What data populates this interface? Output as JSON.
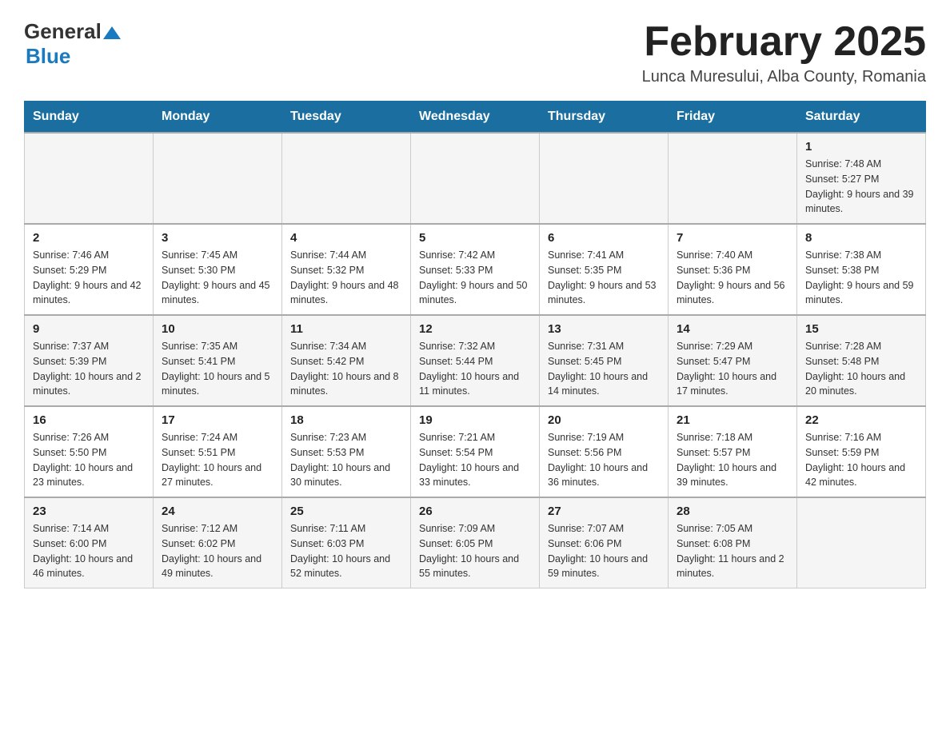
{
  "header": {
    "month_year": "February 2025",
    "location": "Lunca Muresului, Alba County, Romania",
    "logo_general": "General",
    "logo_blue": "Blue"
  },
  "weekdays": [
    "Sunday",
    "Monday",
    "Tuesday",
    "Wednesday",
    "Thursday",
    "Friday",
    "Saturday"
  ],
  "weeks": [
    [
      {
        "day": "",
        "details": ""
      },
      {
        "day": "",
        "details": ""
      },
      {
        "day": "",
        "details": ""
      },
      {
        "day": "",
        "details": ""
      },
      {
        "day": "",
        "details": ""
      },
      {
        "day": "",
        "details": ""
      },
      {
        "day": "1",
        "details": "Sunrise: 7:48 AM\nSunset: 5:27 PM\nDaylight: 9 hours and 39 minutes."
      }
    ],
    [
      {
        "day": "2",
        "details": "Sunrise: 7:46 AM\nSunset: 5:29 PM\nDaylight: 9 hours and 42 minutes."
      },
      {
        "day": "3",
        "details": "Sunrise: 7:45 AM\nSunset: 5:30 PM\nDaylight: 9 hours and 45 minutes."
      },
      {
        "day": "4",
        "details": "Sunrise: 7:44 AM\nSunset: 5:32 PM\nDaylight: 9 hours and 48 minutes."
      },
      {
        "day": "5",
        "details": "Sunrise: 7:42 AM\nSunset: 5:33 PM\nDaylight: 9 hours and 50 minutes."
      },
      {
        "day": "6",
        "details": "Sunrise: 7:41 AM\nSunset: 5:35 PM\nDaylight: 9 hours and 53 minutes."
      },
      {
        "day": "7",
        "details": "Sunrise: 7:40 AM\nSunset: 5:36 PM\nDaylight: 9 hours and 56 minutes."
      },
      {
        "day": "8",
        "details": "Sunrise: 7:38 AM\nSunset: 5:38 PM\nDaylight: 9 hours and 59 minutes."
      }
    ],
    [
      {
        "day": "9",
        "details": "Sunrise: 7:37 AM\nSunset: 5:39 PM\nDaylight: 10 hours and 2 minutes."
      },
      {
        "day": "10",
        "details": "Sunrise: 7:35 AM\nSunset: 5:41 PM\nDaylight: 10 hours and 5 minutes."
      },
      {
        "day": "11",
        "details": "Sunrise: 7:34 AM\nSunset: 5:42 PM\nDaylight: 10 hours and 8 minutes."
      },
      {
        "day": "12",
        "details": "Sunrise: 7:32 AM\nSunset: 5:44 PM\nDaylight: 10 hours and 11 minutes."
      },
      {
        "day": "13",
        "details": "Sunrise: 7:31 AM\nSunset: 5:45 PM\nDaylight: 10 hours and 14 minutes."
      },
      {
        "day": "14",
        "details": "Sunrise: 7:29 AM\nSunset: 5:47 PM\nDaylight: 10 hours and 17 minutes."
      },
      {
        "day": "15",
        "details": "Sunrise: 7:28 AM\nSunset: 5:48 PM\nDaylight: 10 hours and 20 minutes."
      }
    ],
    [
      {
        "day": "16",
        "details": "Sunrise: 7:26 AM\nSunset: 5:50 PM\nDaylight: 10 hours and 23 minutes."
      },
      {
        "day": "17",
        "details": "Sunrise: 7:24 AM\nSunset: 5:51 PM\nDaylight: 10 hours and 27 minutes."
      },
      {
        "day": "18",
        "details": "Sunrise: 7:23 AM\nSunset: 5:53 PM\nDaylight: 10 hours and 30 minutes."
      },
      {
        "day": "19",
        "details": "Sunrise: 7:21 AM\nSunset: 5:54 PM\nDaylight: 10 hours and 33 minutes."
      },
      {
        "day": "20",
        "details": "Sunrise: 7:19 AM\nSunset: 5:56 PM\nDaylight: 10 hours and 36 minutes."
      },
      {
        "day": "21",
        "details": "Sunrise: 7:18 AM\nSunset: 5:57 PM\nDaylight: 10 hours and 39 minutes."
      },
      {
        "day": "22",
        "details": "Sunrise: 7:16 AM\nSunset: 5:59 PM\nDaylight: 10 hours and 42 minutes."
      }
    ],
    [
      {
        "day": "23",
        "details": "Sunrise: 7:14 AM\nSunset: 6:00 PM\nDaylight: 10 hours and 46 minutes."
      },
      {
        "day": "24",
        "details": "Sunrise: 7:12 AM\nSunset: 6:02 PM\nDaylight: 10 hours and 49 minutes."
      },
      {
        "day": "25",
        "details": "Sunrise: 7:11 AM\nSunset: 6:03 PM\nDaylight: 10 hours and 52 minutes."
      },
      {
        "day": "26",
        "details": "Sunrise: 7:09 AM\nSunset: 6:05 PM\nDaylight: 10 hours and 55 minutes."
      },
      {
        "day": "27",
        "details": "Sunrise: 7:07 AM\nSunset: 6:06 PM\nDaylight: 10 hours and 59 minutes."
      },
      {
        "day": "28",
        "details": "Sunrise: 7:05 AM\nSunset: 6:08 PM\nDaylight: 11 hours and 2 minutes."
      },
      {
        "day": "",
        "details": ""
      }
    ]
  ]
}
